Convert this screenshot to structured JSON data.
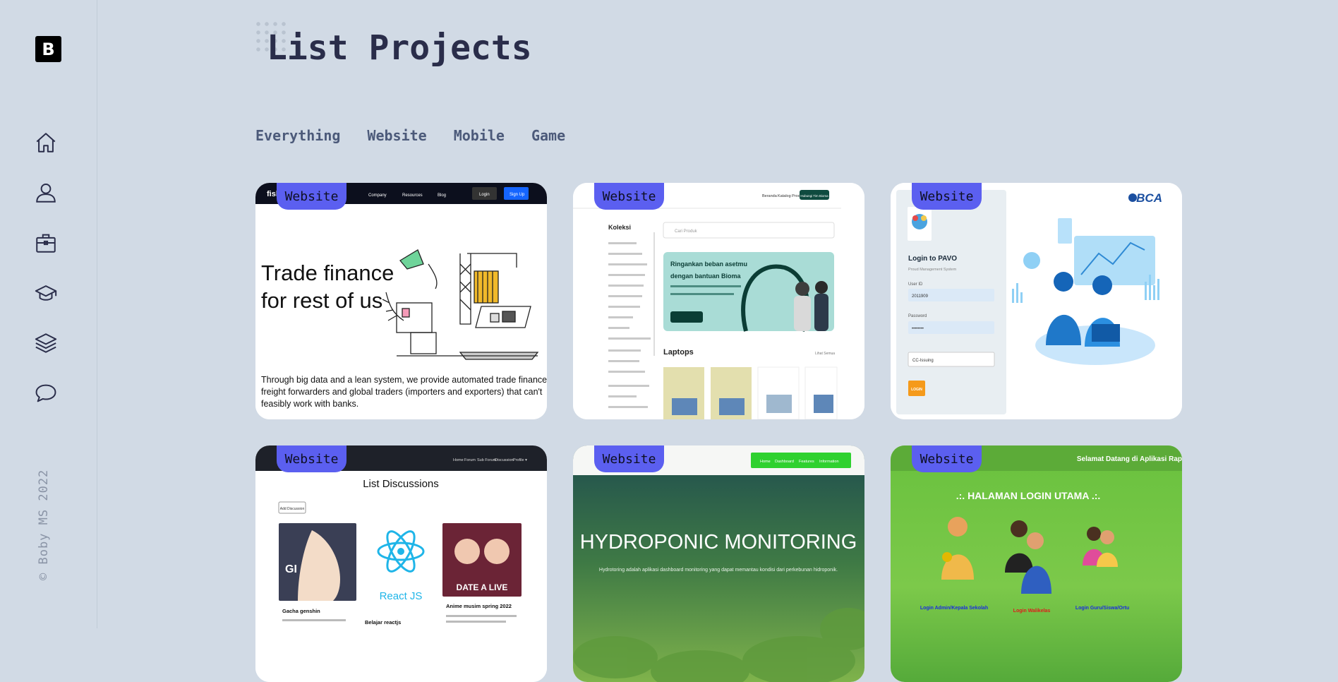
{
  "app": {
    "logo_letter": "B",
    "copyright": "© Boby MS 2022"
  },
  "sidebar": {
    "icons": [
      "home-icon",
      "user-icon",
      "briefcase-icon",
      "graduation-cap-icon",
      "layers-icon",
      "chat-bubble-icon"
    ]
  },
  "page": {
    "title": "List Projects"
  },
  "filters": [
    "Everything",
    "Website",
    "Mobile",
    "Game"
  ],
  "projects": [
    {
      "category": "Website",
      "thumb": {
        "brand": "fish",
        "nav": [
          "Company",
          "Resources",
          "Blog"
        ],
        "login": "Login",
        "signup": "Sign Up",
        "headline_1": "Trade finance",
        "headline_2": "for rest of us",
        "body_1": "Through big data and a lean system, we provide automated trade finance to",
        "body_2": "freight forwarders and global traders (importers and exporters) that can't",
        "body_3": "feasibly work with banks."
      }
    },
    {
      "category": "Website",
      "thumb": {
        "nav": [
          "Beranda",
          "Katalog Produk"
        ],
        "cta": "Hubungi Tim Bioma",
        "sidebar_title": "Koleksi",
        "search": "Cari Produk",
        "hero_1": "Ringankan beban asetmu",
        "hero_2": "dengan bantuan Bioma",
        "section": "Laptops",
        "see_all": "Lihat Semua"
      }
    },
    {
      "category": "Website",
      "thumb": {
        "brand": "BCA",
        "title": "Login to PAVO",
        "subtitle": "Proud Management System",
        "user_label": "User ID",
        "user_value": "2011909",
        "password_label": "Password",
        "password_value": "••••••••",
        "select": "CC-Issuing",
        "button": "LOGIN"
      }
    },
    {
      "category": "Website",
      "thumb": {
        "nav": [
          "Home",
          "Forum",
          "Sub Forum",
          "Discussion",
          "Profile ▾"
        ],
        "title": "List Discussions",
        "add_button": "Add Discussion",
        "items": [
          "Gacha genshin",
          "Belajar reactjs",
          "Anime musim spring 2022"
        ],
        "react_label": "React JS"
      }
    },
    {
      "category": "Website",
      "thumb": {
        "nav": [
          "Home",
          "Dashboard",
          "Features",
          "Information"
        ],
        "title": "HYDROPONIC MONITORING",
        "subtitle": "Hydrotoring adalah aplikasi dashboard monitoring yang dapat memantau kondisi dari perkebunan hidroponik."
      }
    },
    {
      "category": "Website",
      "thumb": {
        "marquee": "Selamat Datang di Aplikasi Rap",
        "title": ".:. HALAMAN LOGIN UTAMA .:.",
        "links": [
          "Login Admin/Kepala Sekolah",
          "Login Walikelas",
          "Login Guru/Siswa/Ortu"
        ]
      }
    }
  ],
  "colors": {
    "background": "#d1dae5",
    "badge": "#5b5ff0",
    "title": "#2a2d4a",
    "filter": "#4c5a7a"
  }
}
